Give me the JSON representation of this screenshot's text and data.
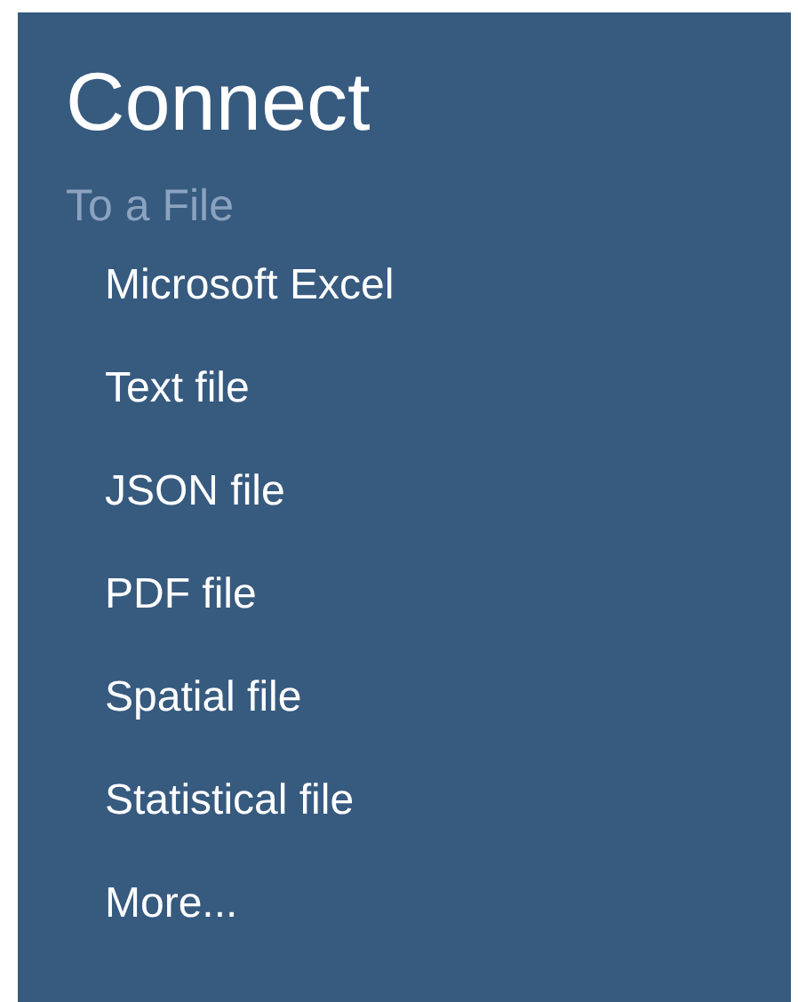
{
  "title": "Connect",
  "section": {
    "heading": "To a File",
    "items": [
      {
        "label": "Microsoft Excel"
      },
      {
        "label": "Text file"
      },
      {
        "label": "JSON file"
      },
      {
        "label": "PDF file"
      },
      {
        "label": "Spatial file"
      },
      {
        "label": "Statistical file"
      },
      {
        "label": "More..."
      }
    ]
  }
}
